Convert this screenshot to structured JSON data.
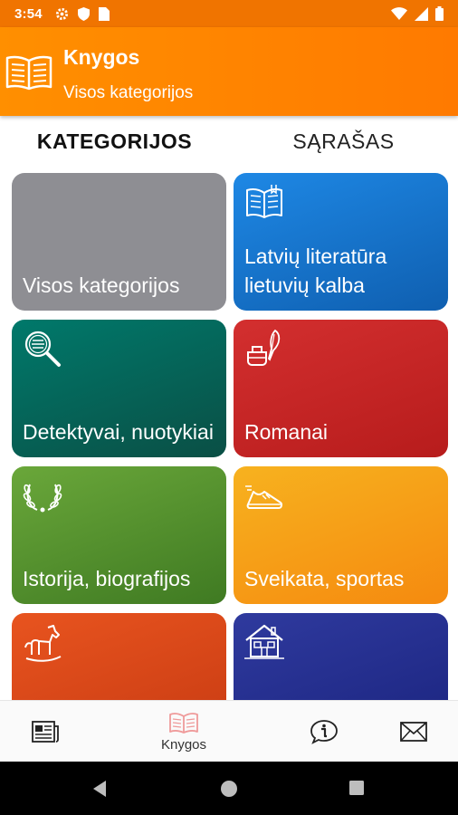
{
  "status_bar": {
    "time": "3:54",
    "left_icons": [
      "gear-icon",
      "shield-icon",
      "sim-card-icon"
    ],
    "right_icons": [
      "wifi-icon",
      "signal-icon",
      "battery-icon"
    ]
  },
  "app_bar": {
    "title": "Knygos",
    "subtitle": "Visos kategorijos",
    "logo_icon": "open-book-icon"
  },
  "tabs": [
    {
      "label": "KATEGORIJOS",
      "active": true
    },
    {
      "label": "SĄRAŠAS",
      "active": false
    }
  ],
  "categories": [
    {
      "label": "Visos kategorijos",
      "icon": "",
      "color": "#8e8e93"
    },
    {
      "label": "Latvių literatūra lietuvių kalba",
      "icon": "open-book-icon",
      "color": "#1976d2"
    },
    {
      "label": "Detektyvai, nuotykiai",
      "icon": "magnifier-icon",
      "color": "#00695c"
    },
    {
      "label": "Romanai",
      "icon": "inkwell-quill-icon",
      "color": "#c62828"
    },
    {
      "label": "Istorija, biografijos",
      "icon": "laurel-wreath-icon",
      "color": "#558b2f"
    },
    {
      "label": "Sveikata, sportas",
      "icon": "running-shoe-icon",
      "color": "#f9a825"
    },
    {
      "label": "",
      "icon": "rocking-horse-icon",
      "color": "#d84315"
    },
    {
      "label": "",
      "icon": "house-icon",
      "color": "#283593"
    }
  ],
  "bottom_nav": [
    {
      "label": "",
      "icon": "newspaper-icon"
    },
    {
      "label": "Knygos",
      "icon": "book-icon",
      "active": true
    },
    {
      "label": "",
      "icon": "info-icon"
    },
    {
      "label": "",
      "icon": "envelope-icon"
    }
  ],
  "system_nav": [
    "back-button",
    "home-button",
    "recents-button"
  ],
  "colors": {
    "accent": "#ff8000",
    "active_nav_icon": "#ef9a9a"
  }
}
